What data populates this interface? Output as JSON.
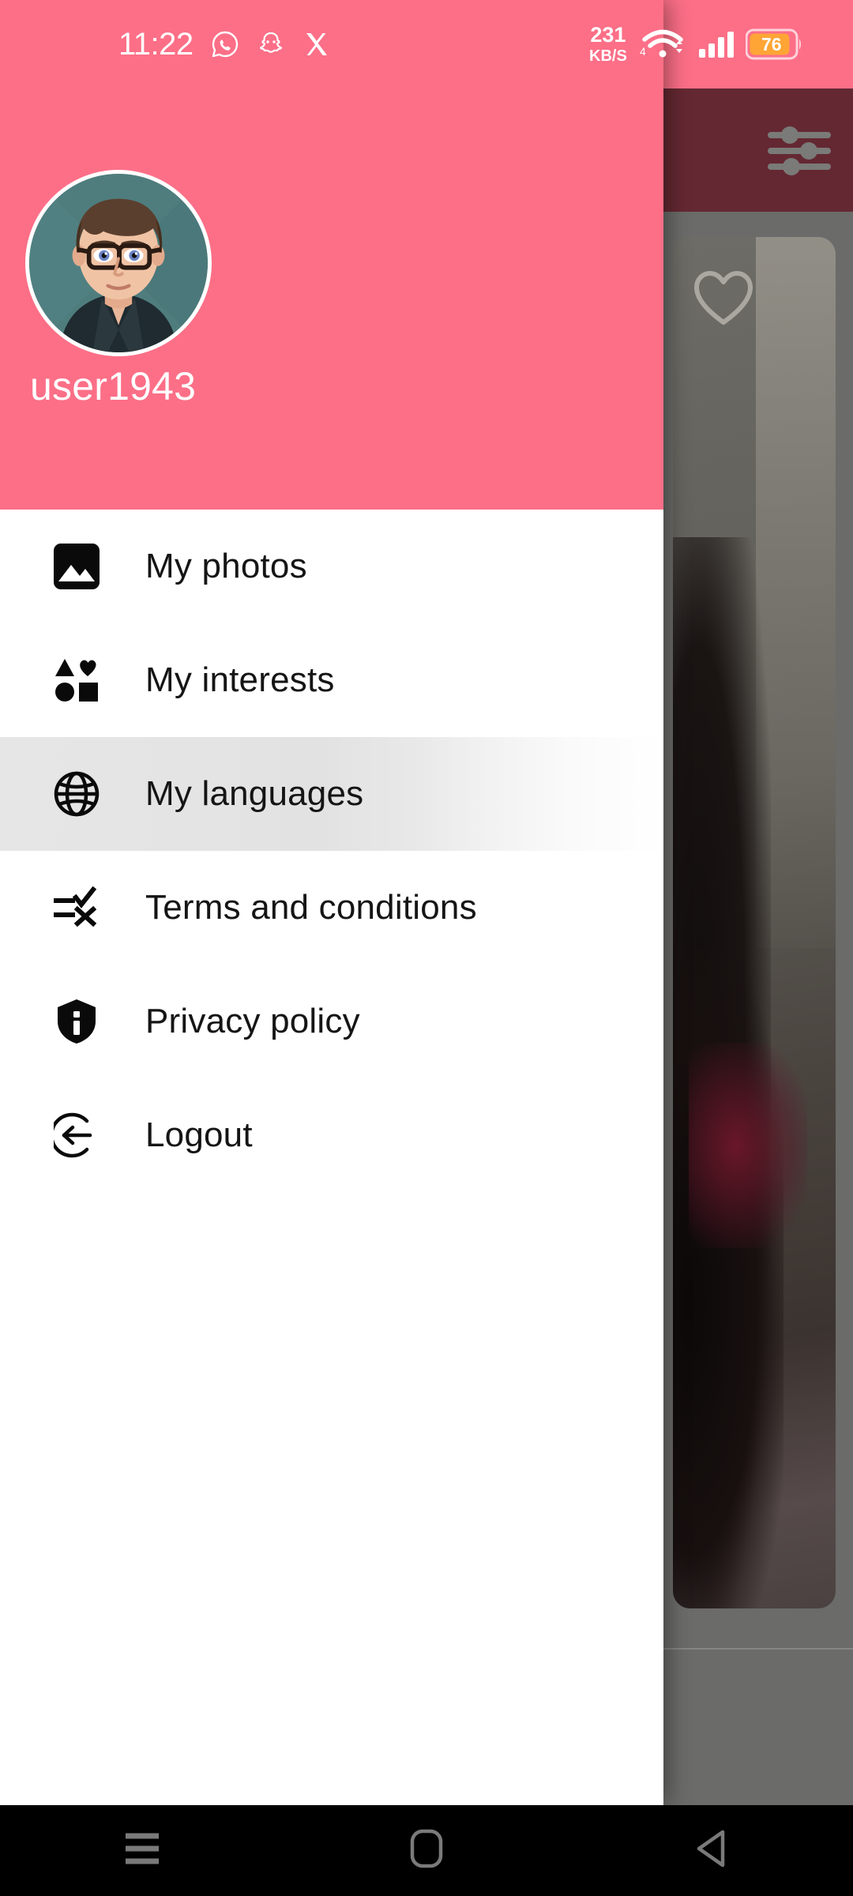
{
  "status_bar": {
    "time": "11:22",
    "left_icons": [
      "whatsapp-icon",
      "snapchat-icon",
      "x-twitter-icon"
    ],
    "network_speed_value": "231",
    "network_speed_unit": "KB/S",
    "wifi_icon": "wifi-icon",
    "mobile_network_label": "4",
    "signal_icon": "signal-bars-icon",
    "battery_percent": "76",
    "background_color": "#fc6f87"
  },
  "drawer": {
    "header": {
      "avatar": "user-avatar",
      "username": "user1943",
      "background_color": "#fc6f87"
    },
    "menu_items": [
      {
        "label": "My photos",
        "icon": "photo-icon",
        "highlighted": false
      },
      {
        "label": "My interests",
        "icon": "shapes-icon",
        "highlighted": false
      },
      {
        "label": "My languages",
        "icon": "globe-icon",
        "highlighted": true
      },
      {
        "label": "Terms and conditions",
        "icon": "checklist-icon",
        "highlighted": false
      },
      {
        "label": "Privacy policy",
        "icon": "shield-info-icon",
        "highlighted": false
      },
      {
        "label": "Logout",
        "icon": "logout-icon",
        "highlighted": false
      }
    ]
  },
  "background_app": {
    "appbar_color": "#642832",
    "filter_icon": "sliders-filter-icon",
    "photo_card_like_icon": "heart-outline-icon",
    "scrim_color": "#6b6b69"
  },
  "nav_bar": {
    "buttons": [
      {
        "name": "recents-button",
        "icon": "menu-lines-icon"
      },
      {
        "name": "home-button",
        "icon": "rounded-square-icon"
      },
      {
        "name": "back-button",
        "icon": "triangle-left-icon"
      }
    ],
    "background_color": "#000000"
  }
}
